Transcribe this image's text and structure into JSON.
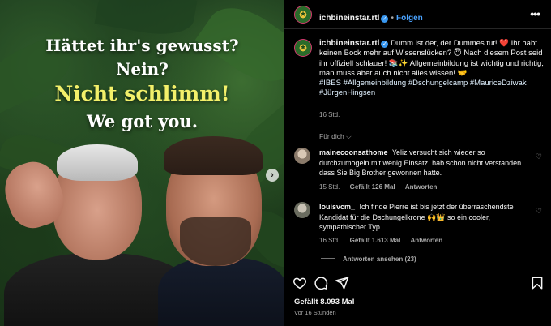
{
  "media": {
    "headline_1": "Hättet ihr's gewusst?",
    "headline_2": "Nein?",
    "headline_3": "Nicht schlimm!",
    "headline_4": "We got you."
  },
  "header": {
    "username": "ichbineinstar.rtl",
    "follow_label": "Folgen",
    "more_label": "•••"
  },
  "caption": {
    "username": "ichbineinstar.rtl",
    "text": "Dumm ist der, der Dummes tut! ❤️ Ihr habt keinen Bock mehr auf Wissenslücken? 😇 Nach diesem Post seid ihr offiziell schlauer! 📚✨ Allgemeinbildung ist wichtig und richtig, man muss aber auch nicht alles wissen! 🤝",
    "hashtags": "#IBES #Allgemeinbildung #Dschungelcamp #MauriceDziwak #JürgenHingsen",
    "time": "16 Std."
  },
  "translate_label": "Für dich ⌵",
  "comments": [
    {
      "username": "mainecoonsathome",
      "text": "Yeliz versucht sich wieder so durchzumogeln mit wenig Einsatz, hab schon nicht verstanden dass Sie Big Brother gewonnen hatte.",
      "time": "15 Std.",
      "likes": "Gefällt 126 Mal",
      "reply_label": "Antworten"
    },
    {
      "username": "louisvcm_",
      "text": "Ich finde Pierre ist bis jetzt der überraschendste Kandidat für die Dschungelkrone 🙌👑 so ein cooler, sympathischer Typ",
      "time": "16 Std.",
      "likes": "Gefällt 1.613 Mal",
      "reply_label": "Antworten",
      "view_replies": "Antworten ansehen (23)"
    }
  ],
  "actions": {
    "likes": "Gefällt 8.093 Mal",
    "date": "Vor 16 Stunden"
  },
  "colors": {
    "accent_link": "#4aa3ff",
    "headline_yellow": "#f3f06a",
    "background": "#000000",
    "muted": "#a8a8a8"
  },
  "icons": [
    "heart-icon",
    "comment-icon",
    "share-icon",
    "bookmark-icon",
    "more-icon",
    "verified-icon",
    "next-arrow-icon"
  ]
}
